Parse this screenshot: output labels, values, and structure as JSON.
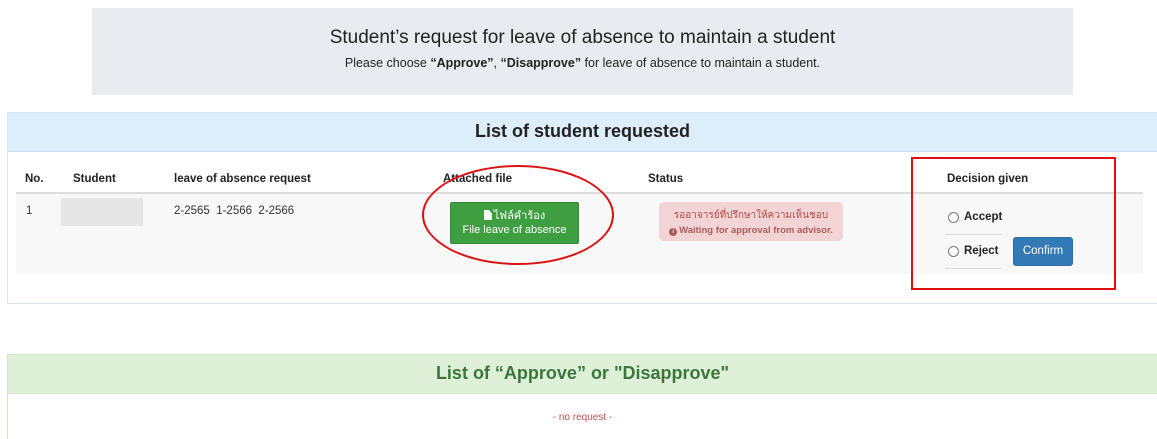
{
  "header": {
    "title": "Student’s request for leave of absence to maintain a student",
    "subtitle_prefix": "Please choose ",
    "subtitle_approve": "“Approve”",
    "subtitle_comma": ", ",
    "subtitle_disapprove": "“Disapprove”",
    "subtitle_suffix": " for leave of absence to maintain a student."
  },
  "requested_panel": {
    "title": "List of student requested",
    "columns": [
      "No.",
      "Student",
      "leave of absence request",
      "Attached file",
      "Status",
      "Decision given"
    ],
    "rows": [
      {
        "no": "1",
        "student": "",
        "leave_request": "2-2565  1-2566  2-2566",
        "file_button_th": "ไฟล์คำร้อง",
        "file_button_en": "File leave of absence",
        "status_th": "รออาจารย์ที่ปรึกษาให้ความเห็นชอบ",
        "status_en": "Waiting for approval from advisor.",
        "decision": {
          "accept_label": "Accept",
          "reject_label": "Reject",
          "confirm_label": "Confirm"
        }
      }
    ]
  },
  "approved_panel": {
    "title": "List of “Approve” or \"Disapprove\"",
    "empty_text": "- no request -"
  },
  "icons": {
    "file": "file-icon",
    "info": "info-circle-icon"
  },
  "colors": {
    "file_button": "#3e9f40",
    "confirm_button": "#337ab7",
    "status_badge": "#f3d4d4",
    "highlight": "#e01010"
  }
}
